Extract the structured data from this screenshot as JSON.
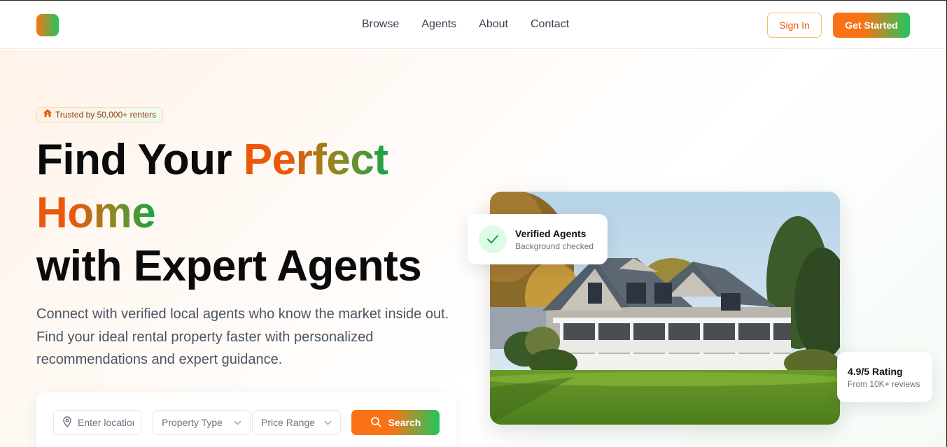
{
  "nav": {
    "links": [
      "Browse",
      "Agents",
      "About",
      "Contact"
    ],
    "sign_in": "Sign In",
    "get_started": "Get Started"
  },
  "hero": {
    "badge_icon": "house-icon",
    "badge": "Trusted by 50,000+ renters",
    "headline_part1": "Find Your ",
    "headline_highlight1": "Perfect",
    "headline_highlight2": "Home",
    "headline_part2": "with Expert Agents",
    "subtext": "Connect with verified local agents who know the market inside out. Find your ideal rental property faster with personalized recommendations and expert guidance."
  },
  "search": {
    "location_placeholder": "Enter location",
    "property_type": "Property Type",
    "price_range": "Price Range",
    "button": "Search"
  },
  "cards": {
    "verified_title": "Verified Agents",
    "verified_sub": "Background checked",
    "rating_title": "4.9/5 Rating",
    "rating_sub": "From 10K+ reviews"
  },
  "colors": {
    "accent_orange": "#f97316",
    "accent_green": "#22c55e",
    "text_dark": "#0b0b0b",
    "text_muted": "#4b5563"
  }
}
